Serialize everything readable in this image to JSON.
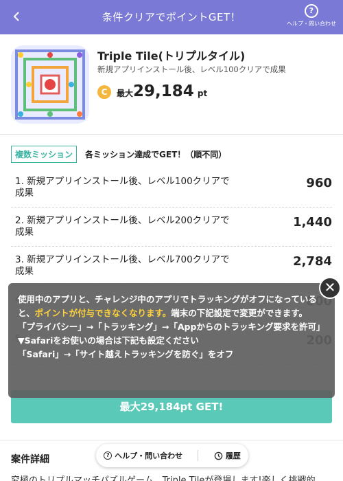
{
  "header": {
    "title": "条件クリアでポイントGET！",
    "help_label": "ヘルプ・問い合わせ"
  },
  "app": {
    "name": "Triple Tile(トリプルタイル)",
    "subtitle": "新規アプリインストール後、レベル100クリアで成果",
    "coin_letter": "C",
    "max_label": "最大",
    "max_points": "29,184",
    "unit": "pt"
  },
  "missions": {
    "badge": "複数ミッション",
    "note": "各ミッション達成でGET！（順不同）",
    "rows": [
      {
        "label": "1. 新規アプリインストール後、レベル100クリアで　　成果",
        "points": "960"
      },
      {
        "label": "2. 新規アプリインストール後、レベル200クリアで　　成果",
        "points": "1,440"
      },
      {
        "label": "3. 新規アプリインストール後、レベル700クリアで　　成果",
        "points": "2,784"
      },
      {
        "label": "4.",
        "points": "800"
      },
      {
        "label": "5.",
        "points": "200"
      }
    ]
  },
  "overlay": {
    "line1a": "使用中のアプリと、チャレンジ中のアプリでトラッキングがオフになっていると、",
    "line1_warn": "ポイントが付与できなくなります。",
    "line1b": "端末の下記設定で変更ができます。",
    "line2": "「プライバシー」→「トラッキング」→「Appからのトラッキング要求を許可」",
    "line3": "▼Safariをお使いの場合は下記も設定ください",
    "line4": "「Safari」→「サイト越えトラッキングを防ぐ」をオフ",
    "close_symbol": "✕"
  },
  "cta": {
    "label": "最大29,184pt GET!"
  },
  "details": {
    "title": "案件詳細",
    "text": "究極のトリプルマッチパズルゲーム、Triple Tileが登場します!楽しく挑戦的"
  },
  "pill": {
    "help": "ヘルプ・問い合わせ",
    "history": "履歴"
  }
}
